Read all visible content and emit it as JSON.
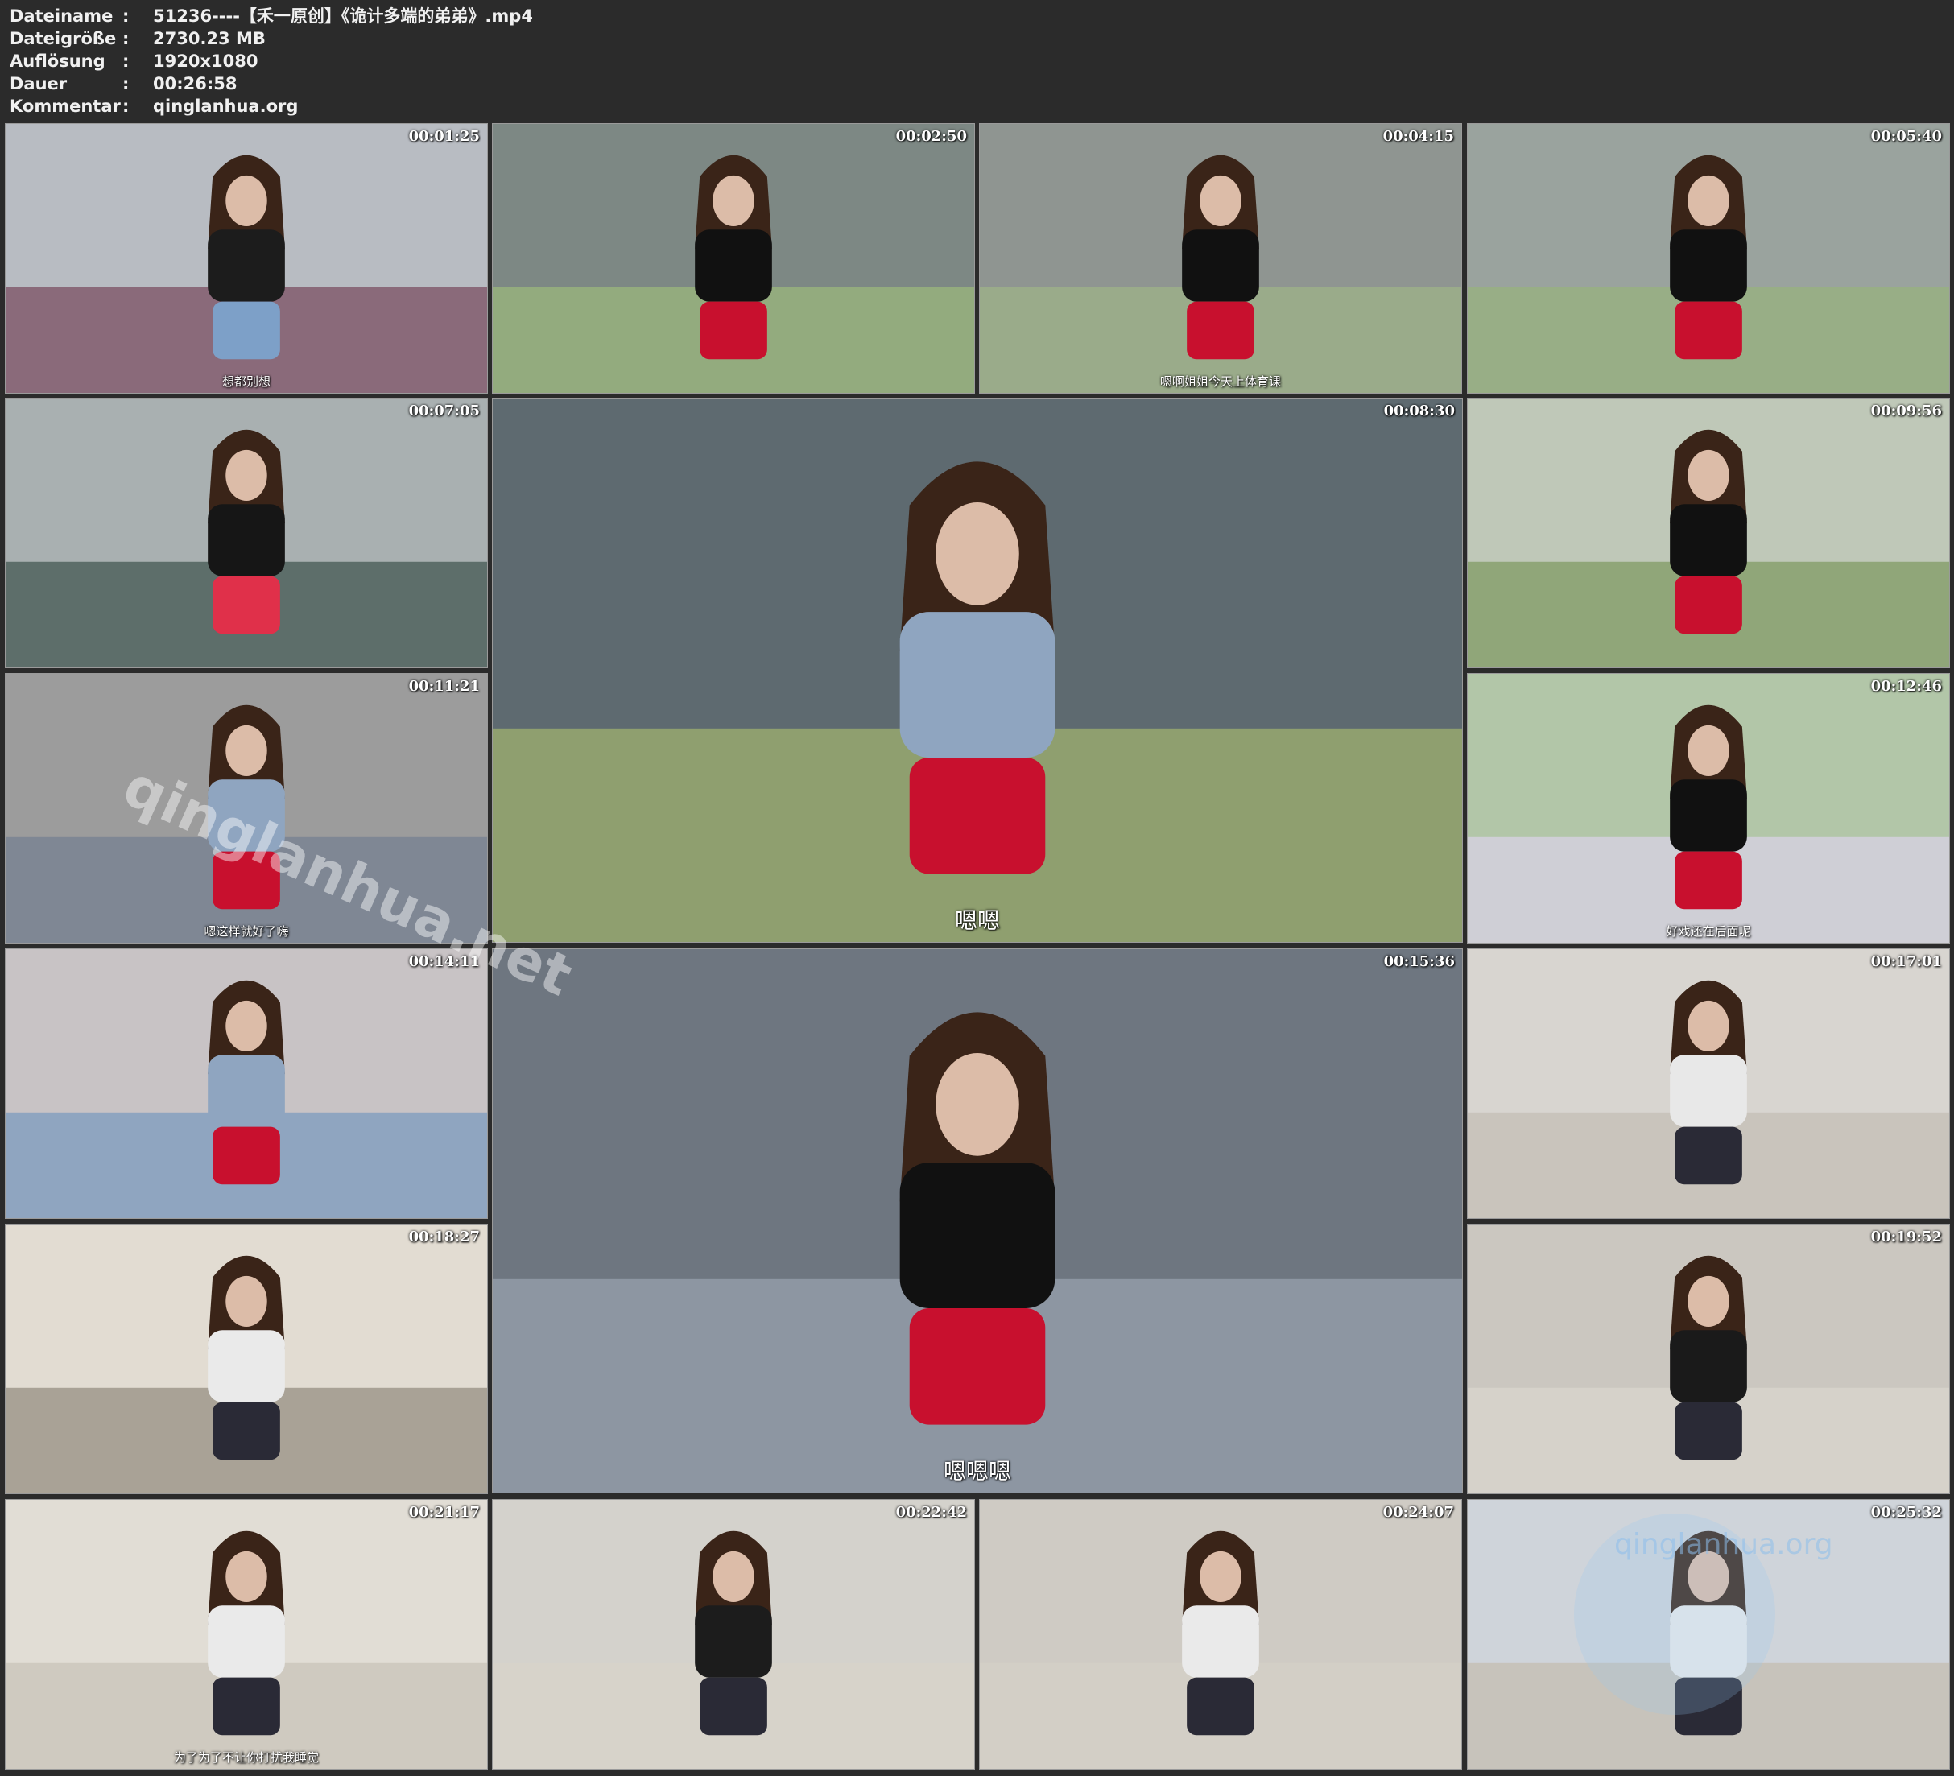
{
  "header": {
    "rows": [
      {
        "key": "Dateiname",
        "sep": ":",
        "value": "51236----【禾一原创】《诡计多端的弟弟》.mp4"
      },
      {
        "key": "Dateigröße",
        "sep": ":",
        "value": "2730.23 MB"
      },
      {
        "key": "Auflösung",
        "sep": ":",
        "value": "1920x1080"
      },
      {
        "key": "Dauer",
        "sep": ":",
        "value": "00:26:58"
      },
      {
        "key": "Kommentar",
        "sep": ":",
        "value": "qinglanhua.org"
      }
    ]
  },
  "thumbs": [
    {
      "time": "00:01:25",
      "subtitle": "想都别想"
    },
    {
      "time": "00:02:50",
      "subtitle": ""
    },
    {
      "time": "00:04:15",
      "subtitle": "嗯啊姐姐今天上体育课"
    },
    {
      "time": "00:05:40",
      "subtitle": ""
    },
    {
      "time": "00:07:05",
      "subtitle": ""
    },
    {
      "time": "00:08:30",
      "subtitle": "嗯嗯"
    },
    {
      "time": "00:09:56",
      "subtitle": ""
    },
    {
      "time": "00:11:21",
      "subtitle": "嗯这样就好了嗨"
    },
    {
      "time": "00:12:46",
      "subtitle": "好戏还在后面呢"
    },
    {
      "time": "00:14:11",
      "subtitle": ""
    },
    {
      "time": "00:15:36",
      "subtitle": "嗯嗯嗯"
    },
    {
      "time": "00:17:01",
      "subtitle": ""
    },
    {
      "time": "00:18:27",
      "subtitle": ""
    },
    {
      "time": "00:19:52",
      "subtitle": ""
    },
    {
      "time": "00:21:17",
      "subtitle": "为了为了不让你打扰我睡觉"
    },
    {
      "time": "00:22:42",
      "subtitle": ""
    },
    {
      "time": "00:24:07",
      "subtitle": ""
    },
    {
      "time": "00:25:32",
      "subtitle": ""
    }
  ],
  "watermarks": {
    "diagonal": "qinglanhua.net",
    "corner": "qinglanhua.org"
  }
}
